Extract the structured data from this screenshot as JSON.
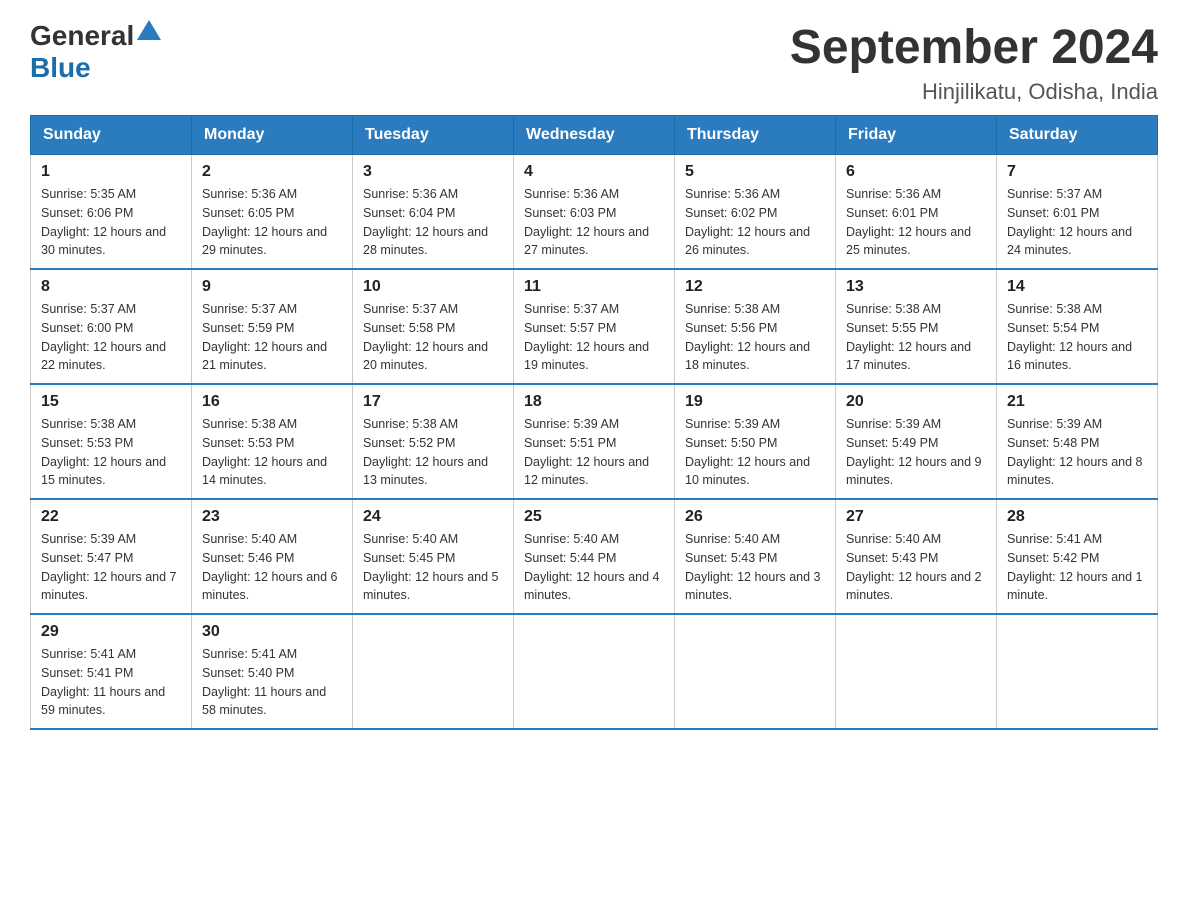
{
  "header": {
    "logo": {
      "general": "General",
      "blue": "Blue",
      "triangle_alt": "triangle icon"
    },
    "title": "September 2024",
    "subtitle": "Hinjilikatu, Odisha, India"
  },
  "columns": [
    "Sunday",
    "Monday",
    "Tuesday",
    "Wednesday",
    "Thursday",
    "Friday",
    "Saturday"
  ],
  "weeks": [
    [
      {
        "day": "1",
        "sunrise": "Sunrise: 5:35 AM",
        "sunset": "Sunset: 6:06 PM",
        "daylight": "Daylight: 12 hours and 30 minutes."
      },
      {
        "day": "2",
        "sunrise": "Sunrise: 5:36 AM",
        "sunset": "Sunset: 6:05 PM",
        "daylight": "Daylight: 12 hours and 29 minutes."
      },
      {
        "day": "3",
        "sunrise": "Sunrise: 5:36 AM",
        "sunset": "Sunset: 6:04 PM",
        "daylight": "Daylight: 12 hours and 28 minutes."
      },
      {
        "day": "4",
        "sunrise": "Sunrise: 5:36 AM",
        "sunset": "Sunset: 6:03 PM",
        "daylight": "Daylight: 12 hours and 27 minutes."
      },
      {
        "day": "5",
        "sunrise": "Sunrise: 5:36 AM",
        "sunset": "Sunset: 6:02 PM",
        "daylight": "Daylight: 12 hours and 26 minutes."
      },
      {
        "day": "6",
        "sunrise": "Sunrise: 5:36 AM",
        "sunset": "Sunset: 6:01 PM",
        "daylight": "Daylight: 12 hours and 25 minutes."
      },
      {
        "day": "7",
        "sunrise": "Sunrise: 5:37 AM",
        "sunset": "Sunset: 6:01 PM",
        "daylight": "Daylight: 12 hours and 24 minutes."
      }
    ],
    [
      {
        "day": "8",
        "sunrise": "Sunrise: 5:37 AM",
        "sunset": "Sunset: 6:00 PM",
        "daylight": "Daylight: 12 hours and 22 minutes."
      },
      {
        "day": "9",
        "sunrise": "Sunrise: 5:37 AM",
        "sunset": "Sunset: 5:59 PM",
        "daylight": "Daylight: 12 hours and 21 minutes."
      },
      {
        "day": "10",
        "sunrise": "Sunrise: 5:37 AM",
        "sunset": "Sunset: 5:58 PM",
        "daylight": "Daylight: 12 hours and 20 minutes."
      },
      {
        "day": "11",
        "sunrise": "Sunrise: 5:37 AM",
        "sunset": "Sunset: 5:57 PM",
        "daylight": "Daylight: 12 hours and 19 minutes."
      },
      {
        "day": "12",
        "sunrise": "Sunrise: 5:38 AM",
        "sunset": "Sunset: 5:56 PM",
        "daylight": "Daylight: 12 hours and 18 minutes."
      },
      {
        "day": "13",
        "sunrise": "Sunrise: 5:38 AM",
        "sunset": "Sunset: 5:55 PM",
        "daylight": "Daylight: 12 hours and 17 minutes."
      },
      {
        "day": "14",
        "sunrise": "Sunrise: 5:38 AM",
        "sunset": "Sunset: 5:54 PM",
        "daylight": "Daylight: 12 hours and 16 minutes."
      }
    ],
    [
      {
        "day": "15",
        "sunrise": "Sunrise: 5:38 AM",
        "sunset": "Sunset: 5:53 PM",
        "daylight": "Daylight: 12 hours and 15 minutes."
      },
      {
        "day": "16",
        "sunrise": "Sunrise: 5:38 AM",
        "sunset": "Sunset: 5:53 PM",
        "daylight": "Daylight: 12 hours and 14 minutes."
      },
      {
        "day": "17",
        "sunrise": "Sunrise: 5:38 AM",
        "sunset": "Sunset: 5:52 PM",
        "daylight": "Daylight: 12 hours and 13 minutes."
      },
      {
        "day": "18",
        "sunrise": "Sunrise: 5:39 AM",
        "sunset": "Sunset: 5:51 PM",
        "daylight": "Daylight: 12 hours and 12 minutes."
      },
      {
        "day": "19",
        "sunrise": "Sunrise: 5:39 AM",
        "sunset": "Sunset: 5:50 PM",
        "daylight": "Daylight: 12 hours and 10 minutes."
      },
      {
        "day": "20",
        "sunrise": "Sunrise: 5:39 AM",
        "sunset": "Sunset: 5:49 PM",
        "daylight": "Daylight: 12 hours and 9 minutes."
      },
      {
        "day": "21",
        "sunrise": "Sunrise: 5:39 AM",
        "sunset": "Sunset: 5:48 PM",
        "daylight": "Daylight: 12 hours and 8 minutes."
      }
    ],
    [
      {
        "day": "22",
        "sunrise": "Sunrise: 5:39 AM",
        "sunset": "Sunset: 5:47 PM",
        "daylight": "Daylight: 12 hours and 7 minutes."
      },
      {
        "day": "23",
        "sunrise": "Sunrise: 5:40 AM",
        "sunset": "Sunset: 5:46 PM",
        "daylight": "Daylight: 12 hours and 6 minutes."
      },
      {
        "day": "24",
        "sunrise": "Sunrise: 5:40 AM",
        "sunset": "Sunset: 5:45 PM",
        "daylight": "Daylight: 12 hours and 5 minutes."
      },
      {
        "day": "25",
        "sunrise": "Sunrise: 5:40 AM",
        "sunset": "Sunset: 5:44 PM",
        "daylight": "Daylight: 12 hours and 4 minutes."
      },
      {
        "day": "26",
        "sunrise": "Sunrise: 5:40 AM",
        "sunset": "Sunset: 5:43 PM",
        "daylight": "Daylight: 12 hours and 3 minutes."
      },
      {
        "day": "27",
        "sunrise": "Sunrise: 5:40 AM",
        "sunset": "Sunset: 5:43 PM",
        "daylight": "Daylight: 12 hours and 2 minutes."
      },
      {
        "day": "28",
        "sunrise": "Sunrise: 5:41 AM",
        "sunset": "Sunset: 5:42 PM",
        "daylight": "Daylight: 12 hours and 1 minute."
      }
    ],
    [
      {
        "day": "29",
        "sunrise": "Sunrise: 5:41 AM",
        "sunset": "Sunset: 5:41 PM",
        "daylight": "Daylight: 11 hours and 59 minutes."
      },
      {
        "day": "30",
        "sunrise": "Sunrise: 5:41 AM",
        "sunset": "Sunset: 5:40 PM",
        "daylight": "Daylight: 11 hours and 58 minutes."
      },
      null,
      null,
      null,
      null,
      null
    ]
  ]
}
